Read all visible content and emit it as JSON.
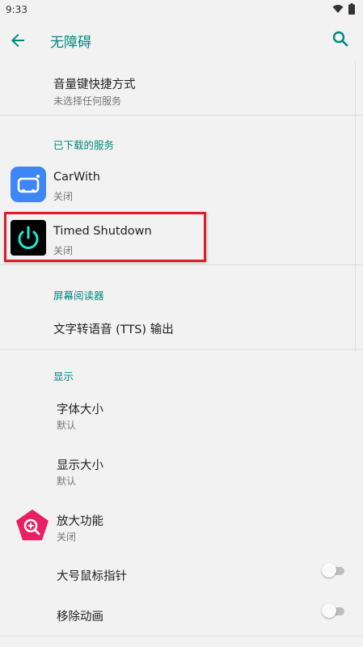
{
  "status_bar": {
    "time": "9:33"
  },
  "app_bar": {
    "title": "无障碍"
  },
  "volume_shortcut": {
    "title": "音量键快捷方式",
    "subtitle": "未选择任何服务"
  },
  "downloaded_services": {
    "header": "已下载的服务",
    "items": [
      {
        "title": "CarWith",
        "subtitle": "关闭"
      },
      {
        "title": "Timed Shutdown",
        "subtitle": "关闭"
      }
    ]
  },
  "screen_reader": {
    "header": "屏幕阅读器",
    "tts": {
      "title": "文字转语音 (TTS) 输出"
    }
  },
  "display": {
    "header": "显示",
    "font_size": {
      "title": "字体大小",
      "subtitle": "默认"
    },
    "display_size": {
      "title": "显示大小",
      "subtitle": "默认"
    },
    "magnification": {
      "title": "放大功能",
      "subtitle": "关闭"
    },
    "large_pointer": {
      "title": "大号鼠标指针",
      "enabled": false
    },
    "remove_animations": {
      "title": "移除动画",
      "enabled": false
    }
  },
  "colors": {
    "accent": "#00897b",
    "highlight": "#d81f26",
    "carwith_icon": "#3e86f5",
    "magnify_icon": "#e91e63"
  }
}
